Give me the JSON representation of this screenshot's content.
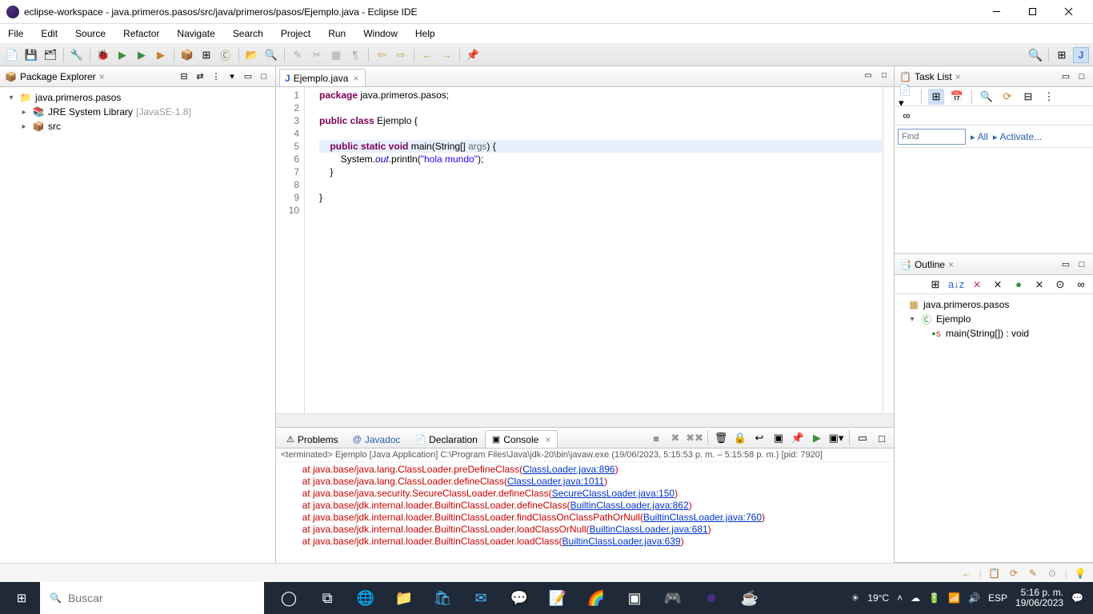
{
  "window": {
    "title": "eclipse-workspace - java.primeros.pasos/src/java/primeros/pasos/Ejemplo.java - Eclipse IDE"
  },
  "menubar": [
    "File",
    "Edit",
    "Source",
    "Refactor",
    "Navigate",
    "Search",
    "Project",
    "Run",
    "Window",
    "Help"
  ],
  "left": {
    "title": "Package Explorer",
    "project": "java.primeros.pasos",
    "jre": "JRE System Library",
    "jre_extra": "[JavaSE-1.8]",
    "src": "src"
  },
  "editor": {
    "tab": "Ejemplo.java",
    "lines": [
      "1",
      "2",
      "3",
      "4",
      "5",
      "6",
      "7",
      "8",
      "9",
      "10"
    ],
    "code": {
      "l1a": "package",
      "l1b": " java.primeros.pasos;",
      "l3a": "public class",
      "l3b": " Ejemplo {",
      "l5a": "    public static void",
      "l5b": " main(String[] ",
      "l5c": "args",
      "l5d": ") {",
      "l6a": "        System.",
      "l6b": "out",
      "l6c": ".println(",
      "l6d": "\"hola mundo\"",
      "l6e": ");",
      "l7": "    }",
      "l9": "}"
    }
  },
  "tasklist": {
    "title": "Task List",
    "find_placeholder": "Find",
    "all": "All",
    "activate": "Activate..."
  },
  "outline": {
    "title": "Outline",
    "pkg": "java.primeros.pasos",
    "class": "Ejemplo",
    "method": "main(String[]) : void"
  },
  "bottom": {
    "tabs": {
      "problems": "Problems",
      "javadoc": "Javadoc",
      "decl": "Declaration",
      "console": "Console"
    },
    "console_header": "<terminated> Ejemplo [Java Application] C:\\Program Files\\Java\\jdk-20\\bin\\javaw.exe  (19/06/2023, 5:15:53 p. m. – 5:15:58 p. m.) [pid: 7920]",
    "lines": [
      {
        "pre": "        at java.base/java.lang.ClassLoader.preDefineClass(",
        "link": "ClassLoader.java:896",
        "post": ")"
      },
      {
        "pre": "        at java.base/java.lang.ClassLoader.defineClass(",
        "link": "ClassLoader.java:1011",
        "post": ")"
      },
      {
        "pre": "        at java.base/java.security.SecureClassLoader.defineClass(",
        "link": "SecureClassLoader.java:150",
        "post": ")"
      },
      {
        "pre": "        at java.base/jdk.internal.loader.BuiltinClassLoader.defineClass(",
        "link": "BuiltinClassLoader.java:862",
        "post": ")"
      },
      {
        "pre": "        at java.base/jdk.internal.loader.BuiltinClassLoader.findClassOnClassPathOrNull(",
        "link": "BuiltinClassLoader.java:760",
        "post": ")"
      },
      {
        "pre": "        at java.base/jdk.internal.loader.BuiltinClassLoader.loadClassOrNull(",
        "link": "BuiltinClassLoader.java:681",
        "post": ")"
      },
      {
        "pre": "        at java.base/jdk.internal.loader.BuiltinClassLoader.loadClass(",
        "link": "BuiltinClassLoader.java:639",
        "post": ")"
      }
    ]
  },
  "taskbar": {
    "search_placeholder": "Buscar",
    "weather": "19°C",
    "lang": "ESP",
    "time": "5:16 p. m.",
    "date": "19/06/2023"
  }
}
